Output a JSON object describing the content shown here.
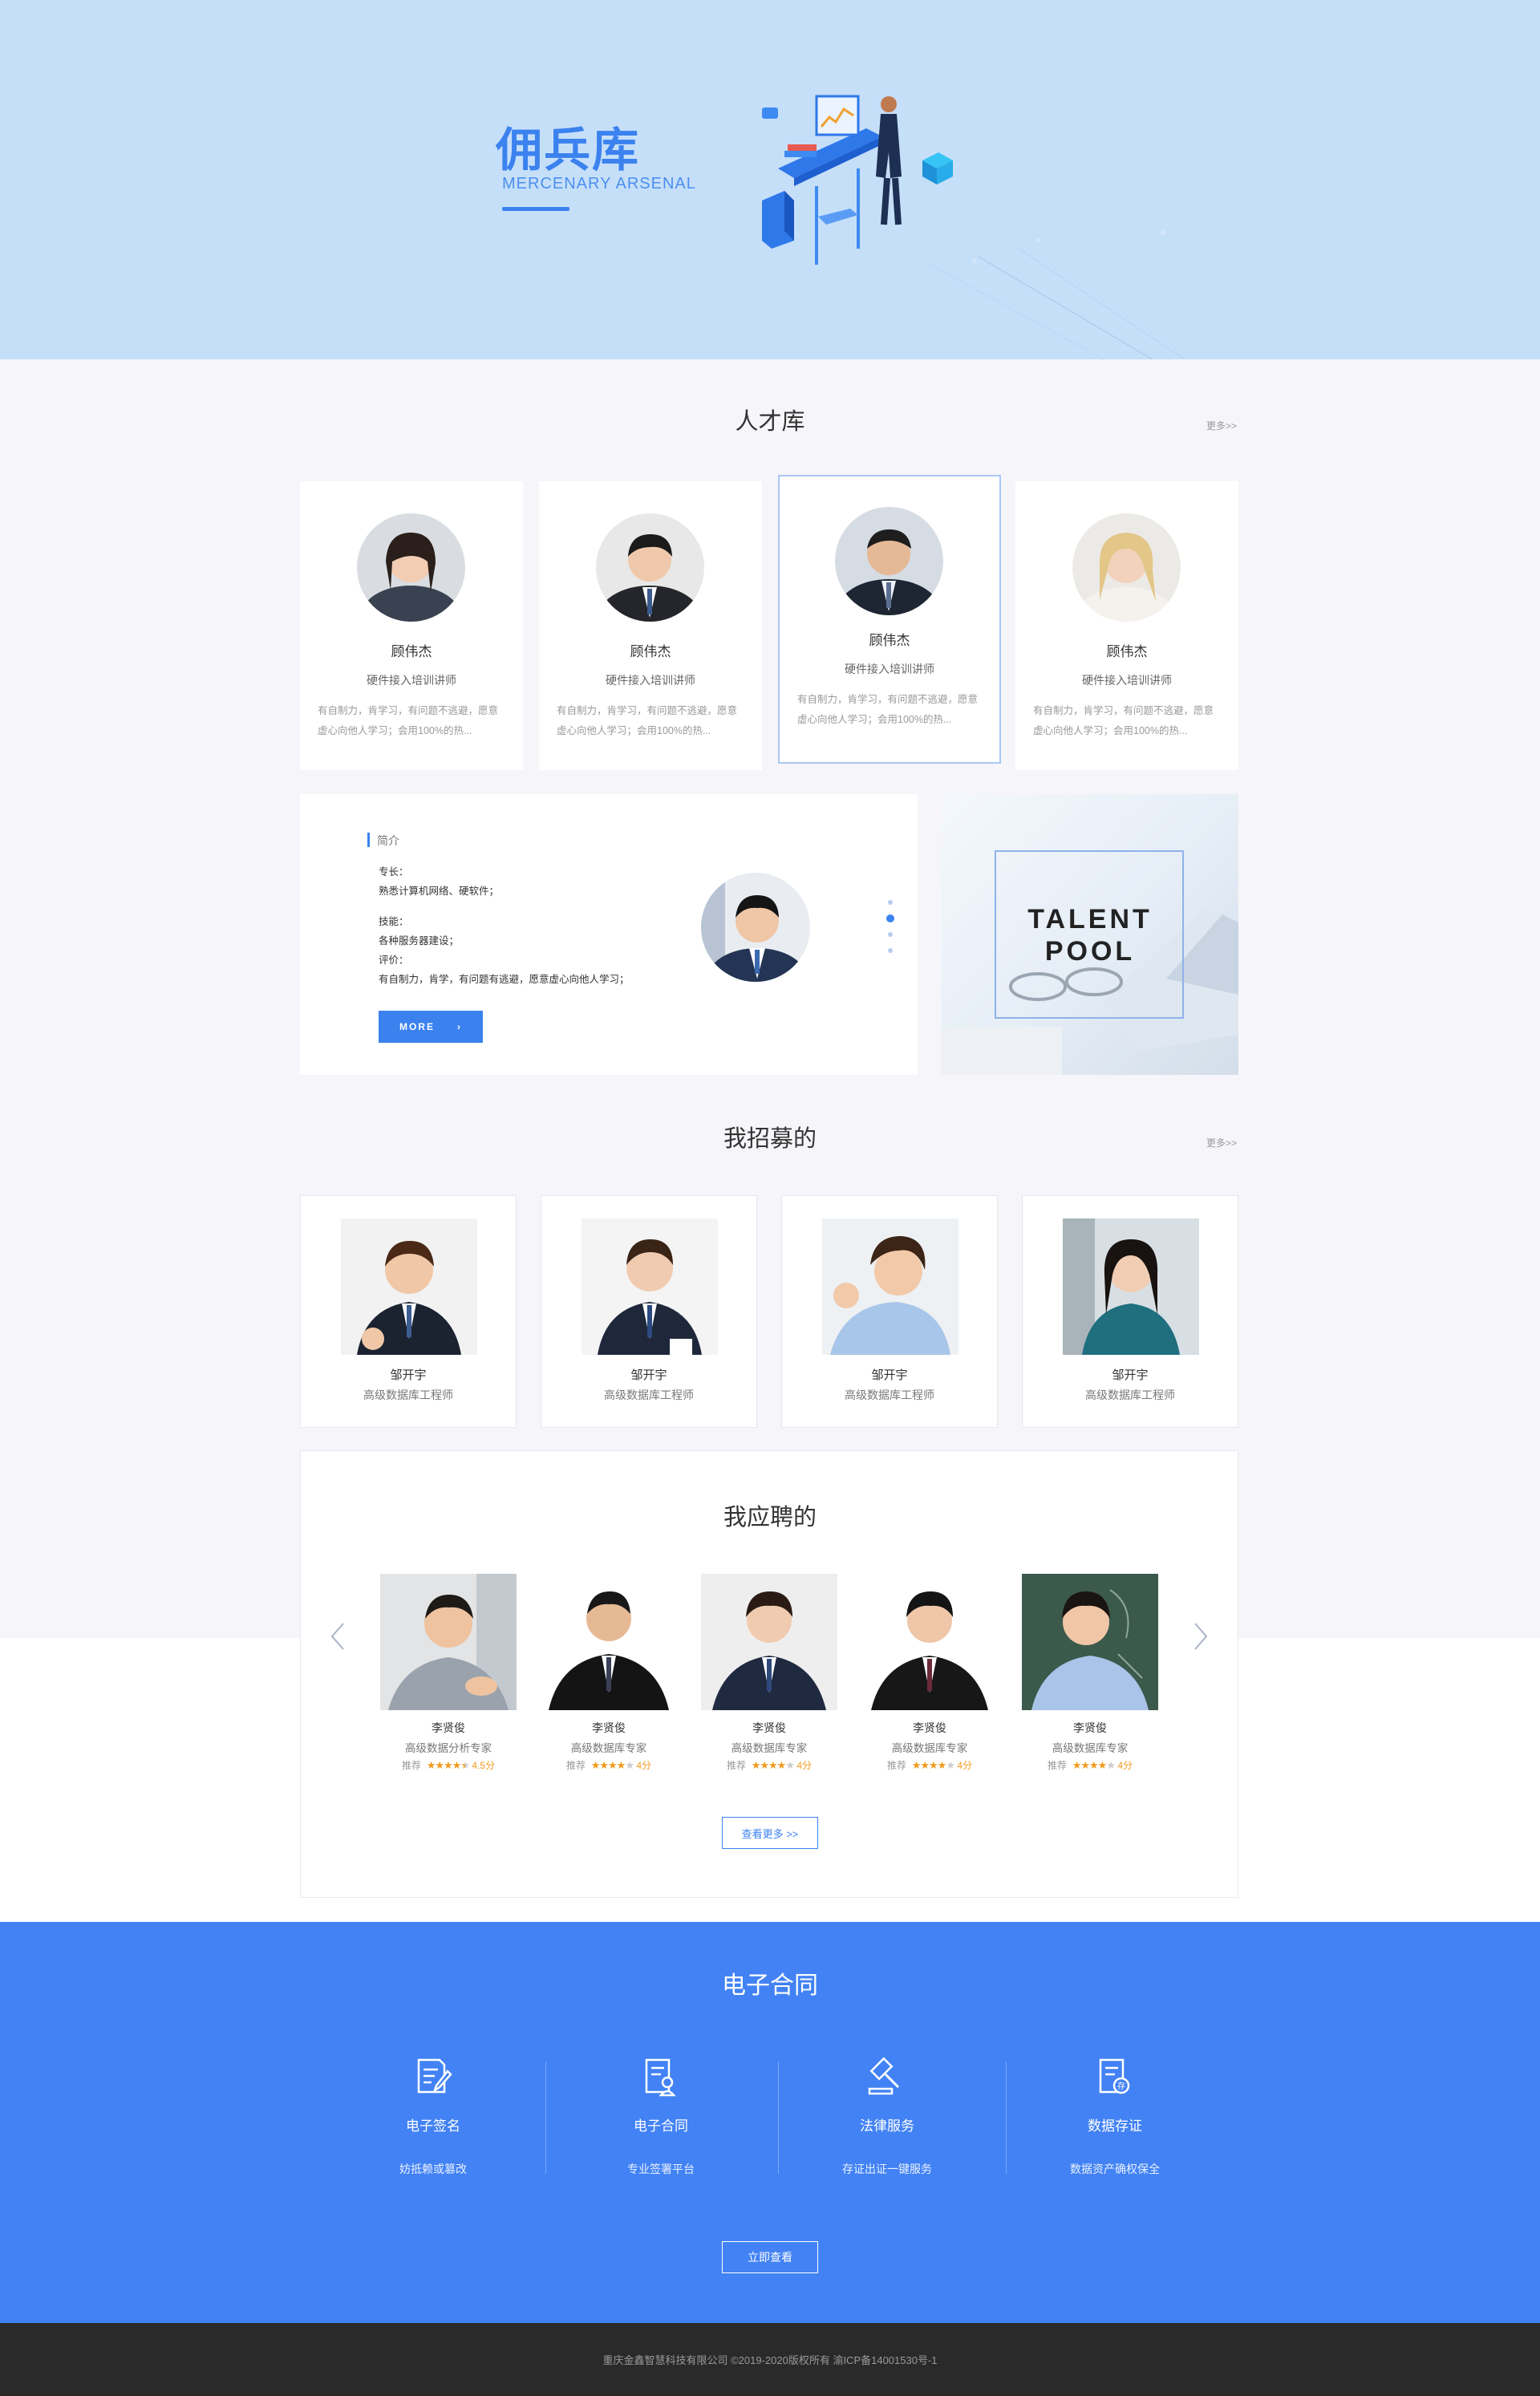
{
  "hero": {
    "title": "佣兵库",
    "subtitle": "MERCENARY ARSENAL"
  },
  "talent": {
    "title": "人才库",
    "more": "更多>>",
    "cards": [
      {
        "name": "顾伟杰",
        "role": "硬件接入培训讲师",
        "desc": "有自制力，肯学习，有问题不逃避，愿意虚心向他人学习；会用100%的热..."
      },
      {
        "name": "顾伟杰",
        "role": "硬件接入培训讲师",
        "desc": "有自制力，肯学习，有问题不逃避，愿意虚心向他人学习；会用100%的热..."
      },
      {
        "name": "顾伟杰",
        "role": "硬件接入培训讲师",
        "desc": "有自制力，肯学习，有问题不逃避，愿意虚心向他人学习；会用100%的热..."
      },
      {
        "name": "顾伟杰",
        "role": "硬件接入培训讲师",
        "desc": "有自制力，肯学习，有问题不逃避，愿意虚心向他人学习；会用100%的热..."
      }
    ]
  },
  "intro": {
    "label": "简介",
    "specialty_label": "专长：",
    "specialty": "熟悉计算机网络、硬软件；",
    "skills_label": "技能：",
    "skills": "各种服务器建设；",
    "eval_label": "评价：",
    "eval": "有自制力，肯学，有问题有逃避，愿意虚心向他人学习；",
    "button": "MORE",
    "pool_text_1": "TALENT",
    "pool_text_2": "POOL"
  },
  "recruit": {
    "title": "我招募的",
    "more": "更多>>",
    "cards": [
      {
        "name": "邹开宇",
        "role": "高级数据库工程师"
      },
      {
        "name": "邹开宇",
        "role": "高级数据库工程师"
      },
      {
        "name": "邹开宇",
        "role": "高级数据库工程师"
      },
      {
        "name": "邹开宇",
        "role": "高级数据库工程师"
      }
    ]
  },
  "applied": {
    "title": "我应聘的",
    "view_more": "查看更多 >>",
    "cards": [
      {
        "name": "李贤俊",
        "role": "高级数据分析专家",
        "rec": "推荐",
        "score": "4.5分",
        "rating": 4.5
      },
      {
        "name": "李贤俊",
        "role": "高级数据库专家",
        "rec": "推荐",
        "score": "4分",
        "rating": 4
      },
      {
        "name": "李贤俊",
        "role": "高级数据库专家",
        "rec": "推荐",
        "score": "4分",
        "rating": 4
      },
      {
        "name": "李贤俊",
        "role": "高级数据库专家",
        "rec": "推荐",
        "score": "4分",
        "rating": 4
      },
      {
        "name": "李贤俊",
        "role": "高级数据库专家",
        "rec": "推荐",
        "score": "4分",
        "rating": 4
      }
    ]
  },
  "contract": {
    "title": "电子合同",
    "services": [
      {
        "name": "电子签名",
        "desc": "妨抵赖或篡改",
        "icon": "sign-document-icon"
      },
      {
        "name": "电子合同",
        "desc": "专业签署平台",
        "icon": "contract-document-icon"
      },
      {
        "name": "法律服务",
        "desc": "存证出证一键服务",
        "icon": "gavel-icon"
      },
      {
        "name": "数据存证",
        "desc": "数据资产确权保全",
        "icon": "certificate-document-icon"
      }
    ],
    "button": "立即查看"
  },
  "footer": {
    "text": "重庆金鑫智慧科技有限公司 ©2019-2020版权所有 渝ICP备14001530号-1"
  },
  "colors": {
    "accent": "#3b82ef",
    "hero_bg": "#c6dff9",
    "blue_section": "#4282f4",
    "footer_bg": "#2a2a2a",
    "star": "#f39a1c"
  }
}
